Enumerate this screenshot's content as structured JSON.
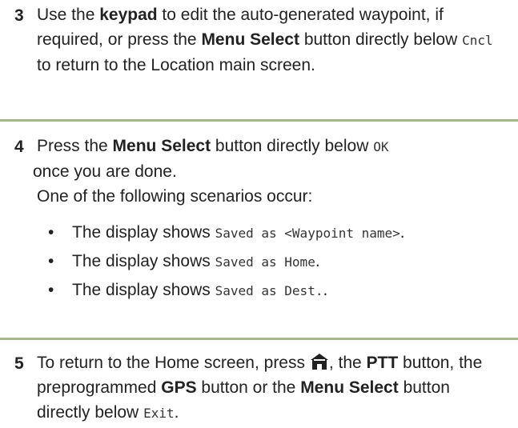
{
  "steps": [
    {
      "number": "3",
      "parts": {
        "a": "Use the ",
        "b_bold": "keypad",
        "c": " to edit the auto-generated waypoint, if required, or press the ",
        "d_bold": "Menu Select",
        "e": " button directly below ",
        "f_mono": "Cncl",
        "g": " to return to the Location main screen."
      }
    },
    {
      "number": "4",
      "parts": {
        "a": "Press the ",
        "b_bold": "Menu Select",
        "c": " button directly below ",
        "d_mono": "OK",
        "e": " once you are done.",
        "f": "One of the following scenarios occur:"
      },
      "bullets": [
        {
          "symbol": "•",
          "text": "The display shows ",
          "mono": "Saved as <Waypoint name>",
          "end": "."
        },
        {
          "symbol": "•",
          "text": "The display shows ",
          "mono": "Saved as Home",
          "end": "."
        },
        {
          "symbol": "•",
          "text": "The display shows ",
          "mono": "Saved as Dest.",
          "end": "."
        }
      ]
    },
    {
      "number": "5",
      "parts": {
        "a": "To return to the Home screen, press ",
        "icon": "home-icon",
        "b": ", the ",
        "c_bold": "PTT",
        "d": " button, the preprogrammed ",
        "e_bold": "GPS",
        "f": " button or the ",
        "g_bold": "Menu Select",
        "h": " button directly below ",
        "i_mono": "Exit",
        "j": "."
      }
    }
  ],
  "colors": {
    "divider": "#a6b58a",
    "text": "#222222"
  }
}
